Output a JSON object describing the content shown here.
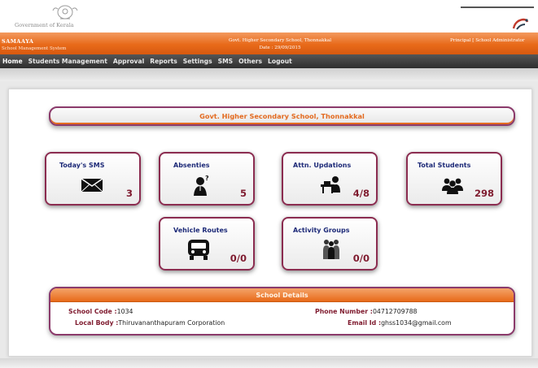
{
  "brand": {
    "govt_label": "Government of Kerala"
  },
  "header": {
    "app_name": "SAMAAYA",
    "app_subtitle": "School Management System",
    "school_name": "Govt. Higher Secondary School, Thonnakkal",
    "date": "Date : 29/09/2015",
    "role": "Principal [ School Administrator"
  },
  "nav": {
    "items": [
      "Home",
      "Students Management",
      "Approval",
      "Reports",
      "Settings",
      "SMS",
      "Others",
      "Logout"
    ]
  },
  "main": {
    "title": "Govt. Higher Secondary School, Thonnakkal",
    "cards": [
      {
        "label": "Today's SMS",
        "value": "3",
        "icon": "envelope-icon"
      },
      {
        "label": "Absenties",
        "value": "5",
        "icon": "absent-student-icon"
      },
      {
        "label": "Attn. Updations",
        "value": "4/8",
        "icon": "desk-student-icon"
      },
      {
        "label": "Total Students",
        "value": "298",
        "icon": "group-icon"
      },
      {
        "label": "Vehicle Routes",
        "value": "0/0",
        "icon": "bus-icon"
      },
      {
        "label": "Activity Groups",
        "value": "0/0",
        "icon": "people-group-icon"
      }
    ]
  },
  "details": {
    "heading": "School Details",
    "school_code_label": "School Code :",
    "school_code": "1034",
    "phone_label": "Phone Number :",
    "phone": "04712709788",
    "local_body_label": "Local Body :",
    "local_body": "Thiruvananthapuram Corporation",
    "email_label": "Email Id :",
    "email": "ghss1034@gmail.com"
  },
  "colors": {
    "header_orange": "#e86a1a",
    "card_border": "#8b2c50",
    "card_label": "#1d2a78",
    "value": "#7f1b2f",
    "nav_bg": "#3a3a3a"
  }
}
